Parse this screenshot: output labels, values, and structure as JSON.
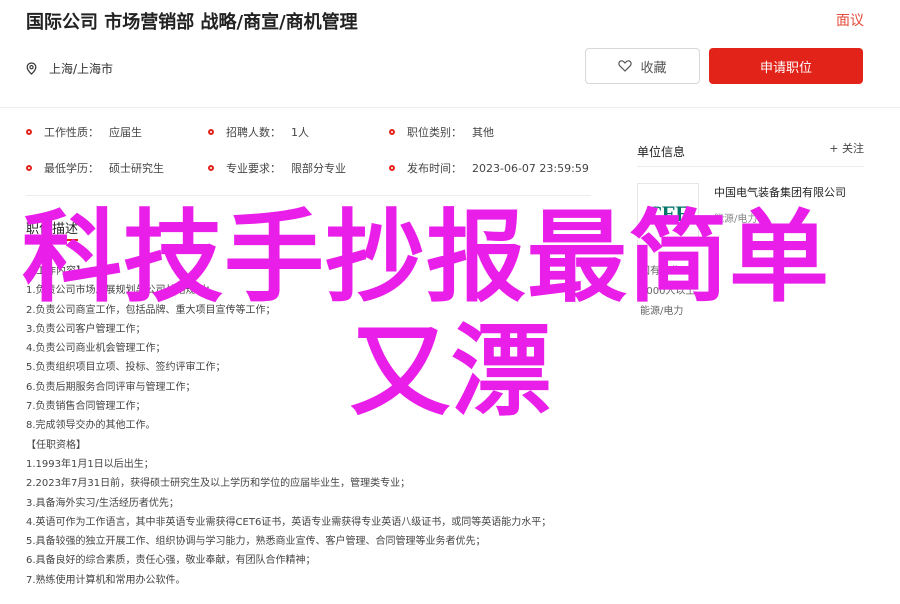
{
  "header": {
    "title": "国际公司 市场营销部 战略/商宣/商机管理",
    "report_label": "面议",
    "location": "上海/上海市",
    "favorite_label": "收藏",
    "apply_label": "申请职位"
  },
  "job_info": [
    {
      "label": "工作性质：",
      "value": "应届生"
    },
    {
      "label": "招聘人数：",
      "value": "1人"
    },
    {
      "label": "职位类别：",
      "value": "其他"
    },
    {
      "label": "最低学历：",
      "value": "硕士研究生"
    },
    {
      "label": "专业要求：",
      "value": "限部分专业"
    },
    {
      "label": "发布时间：",
      "value": "2023-06-07 23:59:59"
    }
  ],
  "description": {
    "section_title": "职位描述",
    "lines": [
      "【工作内容】",
      "1.负责公司市场发展规划与公司战略规划；",
      "2.负责公司商宣工作，包括品牌、重大项目宣传等工作；",
      "3.负责公司客户管理工作；",
      "4.负责公司商业机会管理工作；",
      "5.负责组织项目立项、投标、签约评审工作；",
      "6.负责后期服务合同评审与管理工作；",
      "7.负责销售合同管理工作；",
      "8.完成领导交办的其他工作。",
      "【任职资格】",
      "1.1993年1月1日以后出生；",
      "2.2023年7月31日前，获得硕士研究生及以上学历和学位的应届毕业生，管理类专业；",
      "3.具备海外实习/生活经历者优先；",
      "4.英语可作为工作语言，其中非英语专业需获得CET6证书，英语专业需获得专业英语八级证书，或同等英语能力水平；",
      "5.具备较强的独立开展工作、组织协调与学习能力，熟悉商业宣传、客户管理、合同管理等业务者优先；",
      "6.具备良好的综合素质，责任心强，敬业奉献，有团队合作精神；",
      "7.熟练使用计算机和常用办公软件。"
    ]
  },
  "sidebar": {
    "title": "单位信息",
    "follow_label": "+ 关注",
    "company_name": "中国电气装备集团有限公司",
    "company_sub": "能源/电力",
    "logo_text": "CEE",
    "items": [
      "国有企业",
      "5000人以上",
      "能源/电力"
    ]
  },
  "watermark": {
    "line1": "科技手抄报最简单",
    "line2": "又漂"
  },
  "colors": {
    "accent": "#e2231a",
    "watermark": "#ea1ee9",
    "logo": "#00766b"
  }
}
